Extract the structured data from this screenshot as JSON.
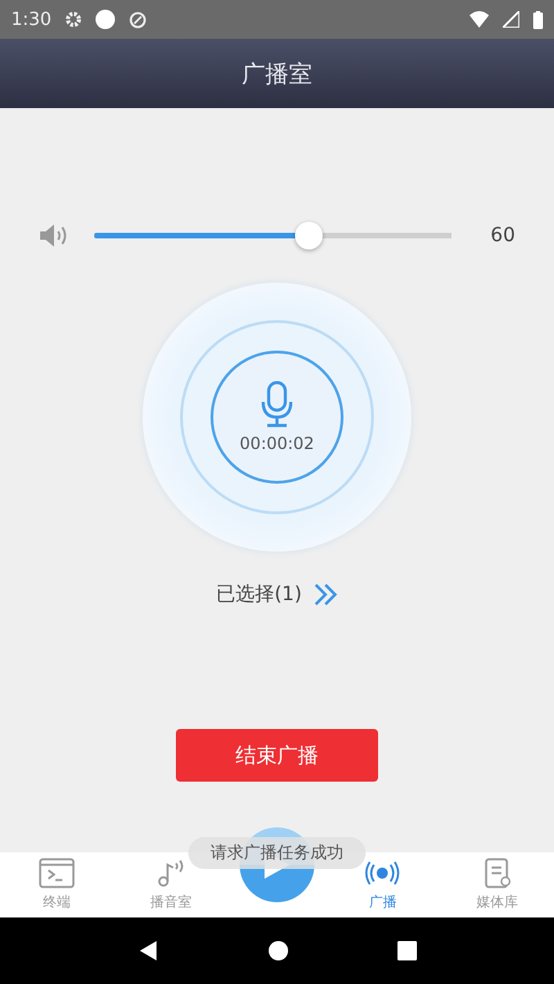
{
  "status_bar": {
    "time": "1:30"
  },
  "header": {
    "title": "广播室"
  },
  "volume": {
    "level": 0.6,
    "reading": "60"
  },
  "recorder": {
    "timer": "00:00:02"
  },
  "selection": {
    "label": "已选择(1)"
  },
  "end_button": {
    "label": "结束广播"
  },
  "toast": {
    "text": "请求广播任务成功"
  },
  "tabs": [
    {
      "kind": "terminal",
      "label": "终端",
      "selected": false
    },
    {
      "kind": "studio",
      "label": "播音室",
      "selected": false
    },
    {
      "kind": "play",
      "selected": false
    },
    {
      "kind": "broadcast",
      "label": "广播",
      "selected": true
    },
    {
      "kind": "media",
      "label": "媒体库",
      "selected": false
    }
  ]
}
